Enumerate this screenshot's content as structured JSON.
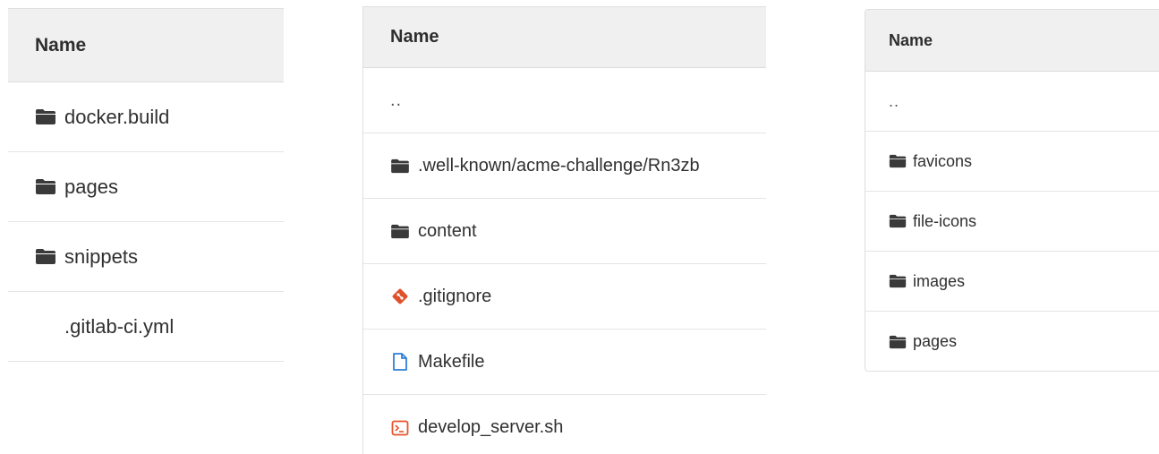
{
  "panels": [
    {
      "header": "Name",
      "rows": [
        {
          "icon": "folder-icon",
          "label": "docker.build"
        },
        {
          "icon": "folder-icon",
          "label": "pages"
        },
        {
          "icon": "folder-icon",
          "label": "snippets"
        },
        {
          "icon": "none",
          "label": ".gitlab-ci.yml"
        }
      ]
    },
    {
      "header": "Name",
      "rows": [
        {
          "icon": "none",
          "label": ".."
        },
        {
          "icon": "folder-icon",
          "label": ".well-known/acme-challenge/Rn3zb"
        },
        {
          "icon": "folder-icon",
          "label": "content"
        },
        {
          "icon": "git-icon",
          "label": ".gitignore"
        },
        {
          "icon": "file-icon",
          "label": "Makefile"
        },
        {
          "icon": "terminal-icon",
          "label": "develop_server.sh"
        }
      ]
    },
    {
      "header": "Name",
      "rows": [
        {
          "icon": "none",
          "label": ".."
        },
        {
          "icon": "folder-icon",
          "label": "favicons"
        },
        {
          "icon": "folder-icon",
          "label": "file-icons"
        },
        {
          "icon": "folder-icon",
          "label": "images"
        },
        {
          "icon": "folder-icon",
          "label": "pages"
        }
      ]
    }
  ],
  "colors": {
    "folder": "#3a3a3a",
    "git": "#e0502b",
    "file": "#2f7fd8",
    "terminal": "#e8542a",
    "header_bg": "#f0f0f0"
  }
}
